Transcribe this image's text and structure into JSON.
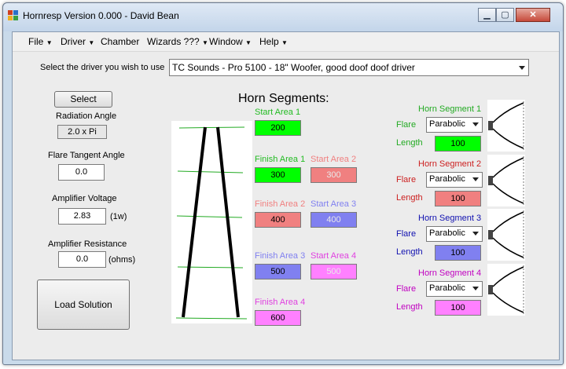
{
  "window": {
    "title": "Hornresp Version 0.000 - David Bean"
  },
  "menu": [
    "File",
    "Driver",
    "Chamber",
    "Wizards ???",
    "Window",
    "Help"
  ],
  "driver": {
    "prompt": "Select the driver you wish to use",
    "selected": "TC Sounds - Pro 5100 - 18\" Woofer, good doof doof driver"
  },
  "left": {
    "select_label": "Select",
    "radiation_angle_label": "Radiation Angle",
    "radiation_angle_value": "2.0 x Pi",
    "flare_tangent_label": "Flare Tangent Angle",
    "flare_tangent_value": "0.0",
    "amp_voltage_label": "Amplifier Voltage",
    "amp_voltage_value": "2.83",
    "amp_voltage_unit": "(1w)",
    "amp_resistance_label": "Amplifier Resistance",
    "amp_resistance_value": "0.0",
    "amp_resistance_unit": "(ohms)",
    "load_label": "Load Solution"
  },
  "horn_title": "Horn Segments:",
  "areas": [
    {
      "label": "Start Area 1",
      "value": "200",
      "label_color": "#22bb22",
      "bg": "#00ff00",
      "text": "#000000"
    },
    {
      "label": "Finish Area 1",
      "value": "300",
      "label_color": "#22bb22",
      "bg": "#00ff00",
      "text": "#000000"
    },
    {
      "label": "Start Area 2",
      "value": "300",
      "label_color": "#f08080",
      "bg": "#f08080",
      "text": "#e8e8e8"
    },
    {
      "label": "Finish Area 2",
      "value": "400",
      "label_color": "#f08080",
      "bg": "#f08080",
      "text": "#000000"
    },
    {
      "label": "Start Area 3",
      "value": "400",
      "label_color": "#8080f0",
      "bg": "#8080f0",
      "text": "#e8e8e8"
    },
    {
      "label": "Finish Area 3",
      "value": "500",
      "label_color": "#8080f0",
      "bg": "#8080f0",
      "text": "#000000"
    },
    {
      "label": "Start Area 4",
      "value": "500",
      "label_color": "#e040e0",
      "bg": "#ff80ff",
      "text": "#e8e8e8"
    },
    {
      "label": "Finish Area 4",
      "value": "600",
      "label_color": "#e040e0",
      "bg": "#ff80ff",
      "text": "#000000"
    }
  ],
  "segments": [
    {
      "title": "Horn Segment 1",
      "color": "#22aa22",
      "flare_label": "Flare",
      "flare_value": "Parabolic",
      "length_label": "Length",
      "length_value": "100",
      "length_bg": "#00ff00"
    },
    {
      "title": "Horn Segment 2",
      "color": "#cc2020",
      "flare_label": "Flare",
      "flare_value": "Parabolic",
      "length_label": "Length",
      "length_value": "100",
      "length_bg": "#f08080"
    },
    {
      "title": "Horn Segment 3",
      "color": "#1010b0",
      "flare_label": "Flare",
      "flare_value": "Parabolic",
      "length_label": "Length",
      "length_value": "100",
      "length_bg": "#8080f0"
    },
    {
      "title": "Horn Segment 4",
      "color": "#c000c0",
      "flare_label": "Flare",
      "flare_value": "Parabolic",
      "length_label": "Length",
      "length_value": "100",
      "length_bg": "#ff80ff"
    }
  ],
  "icons": {
    "app": "app-icon",
    "minimize": "minimize-icon",
    "maximize": "maximize-icon",
    "close": "close-icon",
    "dropdown": "chevron-down-icon"
  }
}
